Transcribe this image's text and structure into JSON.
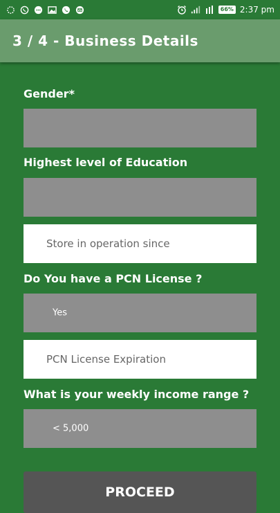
{
  "status_bar": {
    "time": "2:37 pm",
    "battery": "66%",
    "left_icons": [
      "sync-icon",
      "whatsapp-icon",
      "message-icon",
      "gallery-icon",
      "phone-icon",
      "mail-icon"
    ],
    "right_icons": [
      "alarm-icon",
      "signal-icon",
      "data-4g-icon",
      "battery-icon"
    ]
  },
  "app_bar": {
    "title": "3 / 4 - Business Details"
  },
  "form": {
    "gender_label": "Gender*",
    "gender_value": "",
    "education_label": "Highest level of Education",
    "education_value": "",
    "store_since_placeholder": "Store in operation since",
    "pcn_label": "Do You have a PCN License ?",
    "pcn_value": "Yes",
    "pcn_expiration_placeholder": "PCN License Expiration",
    "income_label": "What is your weekly income range ?",
    "income_value": "< 5,000",
    "proceed_label": "PROCEED"
  },
  "colors": {
    "background": "#2a7a36",
    "app_bar": "#6a9c6d",
    "field_gray": "#8e8e8e",
    "field_white": "#ffffff",
    "button": "#555555"
  }
}
